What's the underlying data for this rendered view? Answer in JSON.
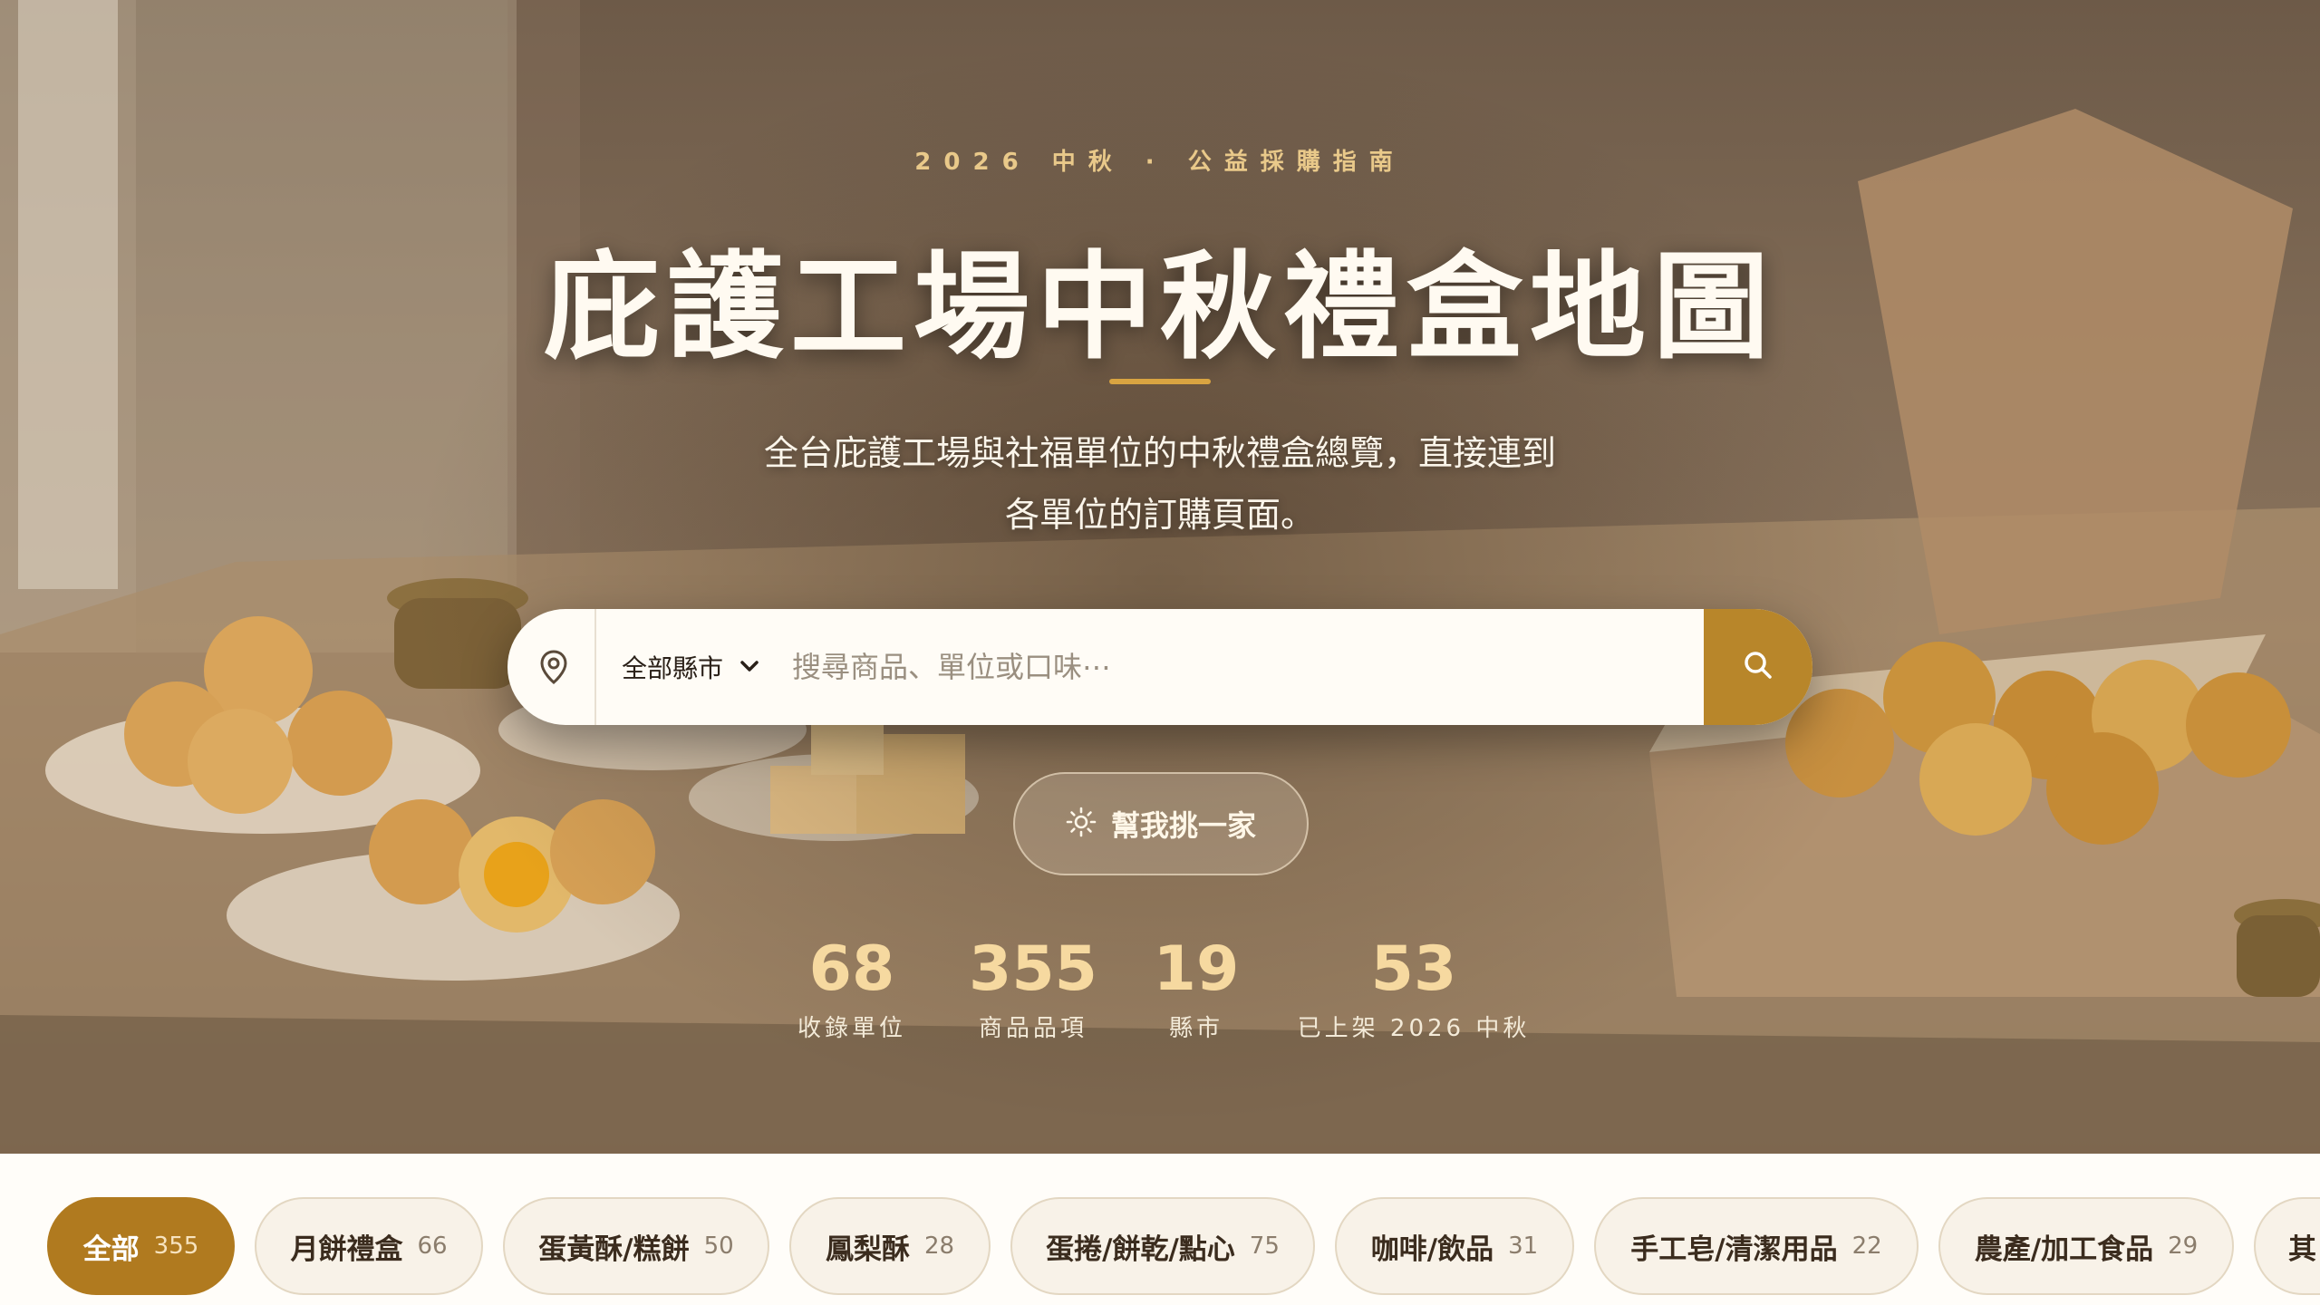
{
  "hero": {
    "eyebrow": "2026 中秋 · 公益採購指南",
    "title": "庇護工場中秋禮盒地圖",
    "subtitle_line1": "全台庇護工場與社福單位的中秋禮盒總覽，直接連到",
    "subtitle_line2": "各單位的訂購頁面。"
  },
  "search": {
    "location_icon": "map-pin-icon",
    "county_selected": "全部縣市",
    "placeholder": "搜尋商品、單位或口味⋯",
    "submit_icon": "search-icon"
  },
  "pick_button": {
    "label": "幫我挑一家",
    "icon": "sparkle-icon"
  },
  "stats": [
    {
      "value": "68",
      "label": "收錄單位"
    },
    {
      "value": "355",
      "label": "商品品項"
    },
    {
      "value": "19",
      "label": "縣市"
    },
    {
      "value": "53",
      "label": "已上架 2026 中秋"
    }
  ],
  "categories": [
    {
      "label": "全部",
      "count": "355",
      "active": true
    },
    {
      "label": "月餅禮盒",
      "count": "66"
    },
    {
      "label": "蛋黃酥/糕餅",
      "count": "50"
    },
    {
      "label": "鳳梨酥",
      "count": "28"
    },
    {
      "label": "蛋捲/餅乾/點心",
      "count": "75"
    },
    {
      "label": "咖啡/飲品",
      "count": "31"
    },
    {
      "label": "手工皂/清潔用品",
      "count": "22"
    },
    {
      "label": "農產/加工食品",
      "count": "29"
    },
    {
      "label": "其",
      "count": ""
    }
  ],
  "colors": {
    "accent": "#b8862a",
    "chip_active": "#b07a1f",
    "stat_number": "#f6d9a0",
    "eyebrow": "#e9c98a"
  }
}
